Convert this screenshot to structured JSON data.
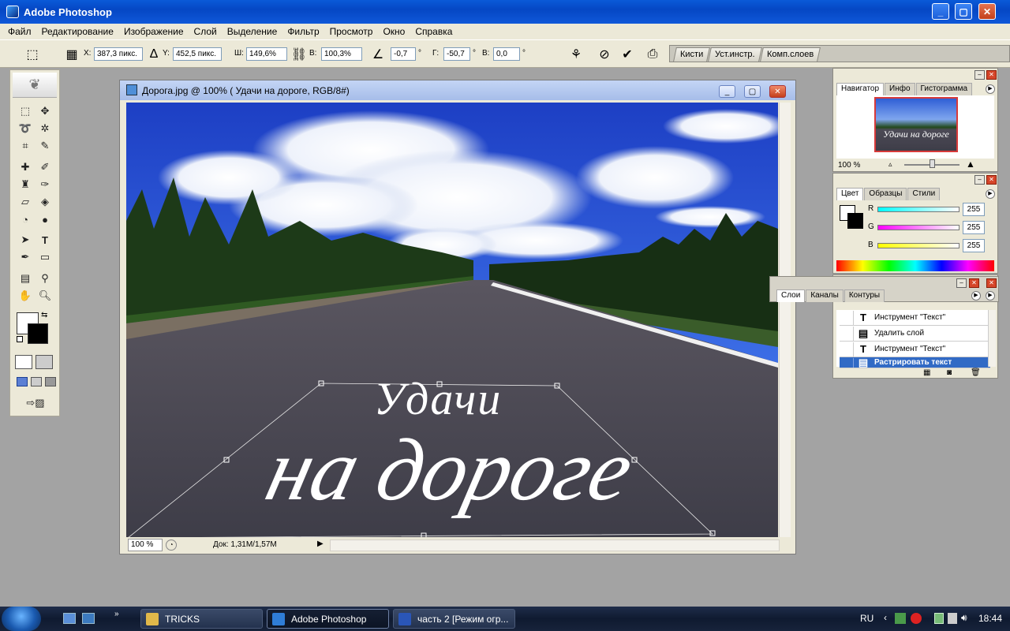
{
  "app": {
    "title": "Adobe Photoshop"
  },
  "menu": [
    "Файл",
    "Редактирование",
    "Изображение",
    "Слой",
    "Выделение",
    "Фильтр",
    "Просмотр",
    "Окно",
    "Справка"
  ],
  "options": {
    "x_label": "X:",
    "x_value": "387,3 пикс.",
    "y_label": "Y:",
    "y_value": "452,5 пикс.",
    "w_label": "Ш:",
    "w_value": "149,6%",
    "h_label": "В:",
    "h_value": "100,3%",
    "angle_value": "-0,7",
    "hskew_label": "Г:",
    "hskew_value": "-50,7",
    "vskew_label": "В:",
    "vskew_value": "0,0",
    "degree": "°"
  },
  "wells": [
    "Кисти",
    "Уст.инстр.",
    "Комп.слоев"
  ],
  "document": {
    "title": "Дорога.jpg @ 100% (  Удачи  на дороге, RGB/8#)",
    "zoom": "100 %",
    "doc_info": "Док: 1,31M/1,57M",
    "text_line1": "Удачи",
    "text_line2": "на дороге"
  },
  "navigator": {
    "tabs": [
      "Навигатор",
      "Инфо",
      "Гистограмма"
    ],
    "zoom": "100 %",
    "thumb_text": "Удачи на дороге"
  },
  "color": {
    "tabs": [
      "Цвет",
      "Образцы",
      "Стили"
    ],
    "channels": [
      {
        "label": "R",
        "value": "255"
      },
      {
        "label": "G",
        "value": "255"
      },
      {
        "label": "B",
        "value": "255"
      }
    ]
  },
  "history": {
    "tabs": [
      "Слои",
      "Каналы",
      "Контуры"
    ],
    "rows": [
      {
        "icon": "T",
        "label": "Инструмент \"Текст\""
      },
      {
        "icon": "▤",
        "label": "Удалить слой"
      },
      {
        "icon": "T",
        "label": "Инструмент \"Текст\""
      },
      {
        "icon": "▤",
        "label": "Растрировать текст"
      }
    ]
  },
  "taskbar": {
    "buttons": [
      "TRICKS",
      "Adobe Photoshop",
      "часть 2 [Режим огр..."
    ],
    "lang": "RU",
    "time": "18:44"
  },
  "colors": {
    "title_blue": "#0547c4",
    "selection": "#316ac5",
    "taskbar": "#0f1a30"
  }
}
